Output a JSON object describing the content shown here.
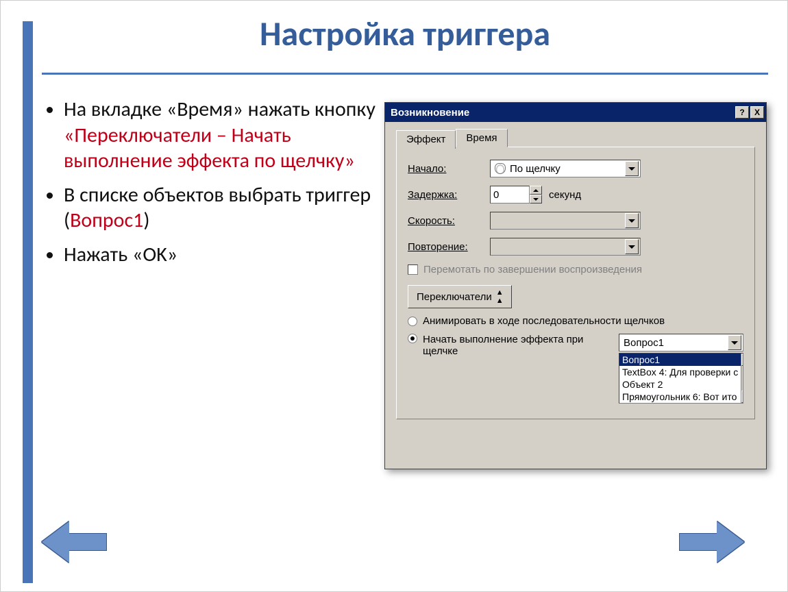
{
  "slide": {
    "title": "Настройка триггера",
    "bullets": [
      {
        "pre": "На вкладке «Время» нажать кнопку ",
        "hl": "«Переключатели – Начать выполнение эффекта по щелчку»",
        "post": ""
      },
      {
        "pre": "В списке объектов выбрать триггер (",
        "hl": "Вопрос1",
        "post": ")"
      },
      {
        "pre": "Нажать «OK»",
        "hl": "",
        "post": ""
      }
    ]
  },
  "dialog": {
    "title": "Возникновение",
    "help_btn": "?",
    "close_btn": "X",
    "tabs": {
      "effect": "Эффект",
      "time": "Время"
    },
    "form": {
      "start_label": "Начало:",
      "start_value": "По щелчку",
      "delay_label": "Задержка:",
      "delay_value": "0",
      "delay_unit": "секунд",
      "speed_label": "Скорость:",
      "repeat_label": "Повторение:",
      "rewind_label": "Перемотать по завершении воспроизведения",
      "switches_btn": "Переключатели",
      "radio1": "Анимировать в ходе последовательности щелчков",
      "radio2": "Начать выполнение эффекта при щелчке",
      "combo_value": "Вопрос1",
      "list": [
        "Вопрос1",
        "TextBox 4: Для проверки с",
        "Объект 2",
        "Прямоугольник 6: Вот ито"
      ]
    }
  }
}
